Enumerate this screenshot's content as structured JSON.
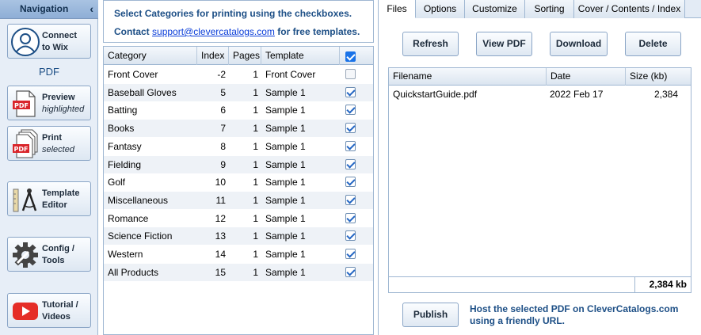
{
  "nav": {
    "title": "Navigation",
    "collapse_icon": "chevron-left-icon",
    "pdf_label": "PDF",
    "buttons": [
      {
        "line1": "Connect",
        "line2": "to Wix",
        "icon": "wix-user-icon"
      },
      {
        "line1": "Preview",
        "line2": "highlighted",
        "icon": "pdf-icon"
      },
      {
        "line1": "Print",
        "line2": "selected",
        "icon": "pdf-stack-icon"
      },
      {
        "line1": "Template",
        "line2": "Editor",
        "icon": "drafting-compass-icon"
      },
      {
        "line1": "Config /",
        "line2": "Tools",
        "icon": "gear-wrench-icon"
      },
      {
        "line1": "Tutorial /",
        "line2": "Videos",
        "icon": "youtube-play-icon"
      }
    ]
  },
  "info": {
    "line1": "Select Categories for printing using the checkboxes.",
    "line2_prefix": "Contact",
    "email": "support@clevercatalogs.com",
    "line2_suffix": "for free templates."
  },
  "categories": {
    "columns": [
      "Category",
      "Index",
      "Pages",
      "Template"
    ],
    "header_checked": true,
    "rows": [
      {
        "category": "Front Cover",
        "index": "-2",
        "pages": "1",
        "template": "Front Cover",
        "checked": false
      },
      {
        "category": "Baseball Gloves",
        "index": "5",
        "pages": "1",
        "template": "Sample 1",
        "checked": true
      },
      {
        "category": "Batting",
        "index": "6",
        "pages": "1",
        "template": "Sample 1",
        "checked": true
      },
      {
        "category": "Books",
        "index": "7",
        "pages": "1",
        "template": "Sample 1",
        "checked": true
      },
      {
        "category": "Fantasy",
        "index": "8",
        "pages": "1",
        "template": "Sample 1",
        "checked": true
      },
      {
        "category": "Fielding",
        "index": "9",
        "pages": "1",
        "template": "Sample 1",
        "checked": true
      },
      {
        "category": "Golf",
        "index": "10",
        "pages": "1",
        "template": "Sample 1",
        "checked": true
      },
      {
        "category": "Miscellaneous",
        "index": "11",
        "pages": "1",
        "template": "Sample 1",
        "checked": true
      },
      {
        "category": "Romance",
        "index": "12",
        "pages": "1",
        "template": "Sample 1",
        "checked": true
      },
      {
        "category": "Science Fiction",
        "index": "13",
        "pages": "1",
        "template": "Sample 1",
        "checked": true
      },
      {
        "category": "Western",
        "index": "14",
        "pages": "1",
        "template": "Sample 1",
        "checked": true
      },
      {
        "category": "All Products",
        "index": "15",
        "pages": "1",
        "template": "Sample 1",
        "checked": true
      }
    ]
  },
  "tabs": [
    {
      "label": "Files",
      "active": true
    },
    {
      "label": "Options",
      "active": false
    },
    {
      "label": "Customize",
      "active": false
    },
    {
      "label": "Sorting",
      "active": false
    },
    {
      "label": "Cover / Contents / Index",
      "active": false
    }
  ],
  "files": {
    "buttons": {
      "refresh": "Refresh",
      "view_pdf": "View PDF",
      "download": "Download",
      "delete": "Delete"
    },
    "columns": [
      "Filename",
      "Date",
      "Size (kb)"
    ],
    "rows": [
      {
        "filename": "QuickstartGuide.pdf",
        "date": "2022 Feb 17",
        "size": "2,384"
      }
    ],
    "total": "2,384 kb",
    "publish_label": "Publish",
    "publish_note": "Host the selected PDF on CleverCatalogs.com using a friendly URL."
  },
  "colors": {
    "accent_blue": "#1d4f86",
    "link_blue": "#0b3ed9",
    "border": "#9fb7d2",
    "checkbox_header": "#1a73e8"
  }
}
